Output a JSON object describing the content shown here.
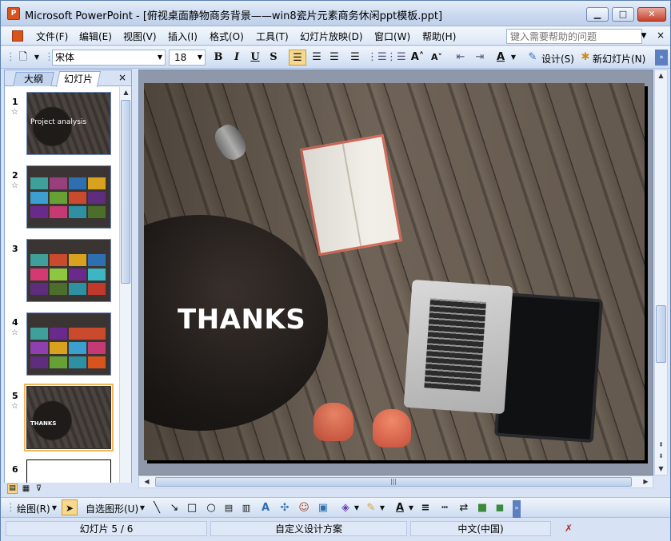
{
  "window": {
    "title": "Microsoft PowerPoint - [俯视桌面静物商务背景——win8瓷片元素商务休闲ppt模板.ppt]",
    "app_icon": "powerpoint-icon",
    "controls": {
      "minimize": "▁",
      "maximize": "□",
      "close": "✕"
    }
  },
  "menubar": {
    "items": [
      "文件(F)",
      "编辑(E)",
      "视图(V)",
      "插入(I)",
      "格式(O)",
      "工具(T)",
      "幻灯片放映(D)",
      "窗口(W)",
      "帮助(H)"
    ],
    "help_placeholder": "键入需要帮助的问题",
    "close_glyph": "×"
  },
  "toolbar": {
    "font_name": "宋体",
    "font_size": "18",
    "bold": "B",
    "italic": "I",
    "underline": "U",
    "shadow": "S",
    "design_label": "设计(S)",
    "new_slide_label": "新幻灯片(N)"
  },
  "left_pane": {
    "tabs": {
      "outline": "大纲",
      "slides": "幻灯片"
    },
    "close_glyph": "×",
    "slides": [
      {
        "number": "1",
        "title": "Project analysis"
      },
      {
        "number": "2",
        "title": ""
      },
      {
        "number": "3",
        "title": ""
      },
      {
        "number": "4",
        "title": ""
      },
      {
        "number": "5",
        "title": "THANKS"
      },
      {
        "number": "6",
        "title": ""
      }
    ],
    "selected_slide": 5
  },
  "slide": {
    "title": "THANKS"
  },
  "drawbar": {
    "draw_label": "绘图(R)",
    "autoshapes_label": "自选图形(U)"
  },
  "status": {
    "slide_position": "幻灯片 5 / 6",
    "design": "自定义设计方案",
    "language": "中文(中国)"
  },
  "colors": {
    "accent": "#f7d98e",
    "window_bg": "#d7e3f4",
    "selection": "#f0b85a"
  }
}
